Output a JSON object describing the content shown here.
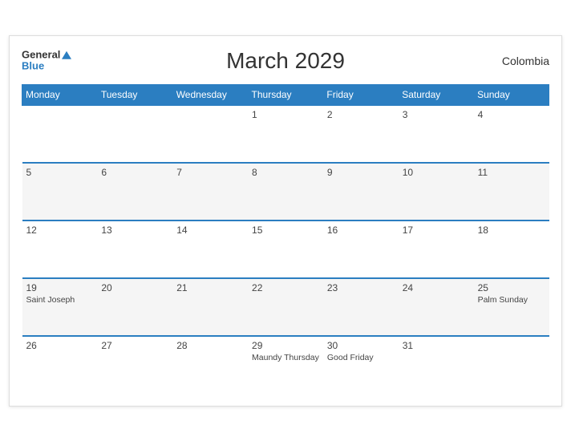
{
  "header": {
    "title": "March 2029",
    "country": "Colombia",
    "logo_general": "General",
    "logo_blue": "Blue"
  },
  "days_of_week": [
    "Monday",
    "Tuesday",
    "Wednesday",
    "Thursday",
    "Friday",
    "Saturday",
    "Sunday"
  ],
  "weeks": [
    [
      {
        "day": "",
        "event": ""
      },
      {
        "day": "",
        "event": ""
      },
      {
        "day": "",
        "event": ""
      },
      {
        "day": "1",
        "event": ""
      },
      {
        "day": "2",
        "event": ""
      },
      {
        "day": "3",
        "event": ""
      },
      {
        "day": "4",
        "event": ""
      }
    ],
    [
      {
        "day": "5",
        "event": ""
      },
      {
        "day": "6",
        "event": ""
      },
      {
        "day": "7",
        "event": ""
      },
      {
        "day": "8",
        "event": ""
      },
      {
        "day": "9",
        "event": ""
      },
      {
        "day": "10",
        "event": ""
      },
      {
        "day": "11",
        "event": ""
      }
    ],
    [
      {
        "day": "12",
        "event": ""
      },
      {
        "day": "13",
        "event": ""
      },
      {
        "day": "14",
        "event": ""
      },
      {
        "day": "15",
        "event": ""
      },
      {
        "day": "16",
        "event": ""
      },
      {
        "day": "17",
        "event": ""
      },
      {
        "day": "18",
        "event": ""
      }
    ],
    [
      {
        "day": "19",
        "event": "Saint Joseph"
      },
      {
        "day": "20",
        "event": ""
      },
      {
        "day": "21",
        "event": ""
      },
      {
        "day": "22",
        "event": ""
      },
      {
        "day": "23",
        "event": ""
      },
      {
        "day": "24",
        "event": ""
      },
      {
        "day": "25",
        "event": "Palm Sunday"
      }
    ],
    [
      {
        "day": "26",
        "event": ""
      },
      {
        "day": "27",
        "event": ""
      },
      {
        "day": "28",
        "event": ""
      },
      {
        "day": "29",
        "event": "Maundy Thursday"
      },
      {
        "day": "30",
        "event": "Good Friday"
      },
      {
        "day": "31",
        "event": ""
      },
      {
        "day": "",
        "event": ""
      }
    ]
  ]
}
